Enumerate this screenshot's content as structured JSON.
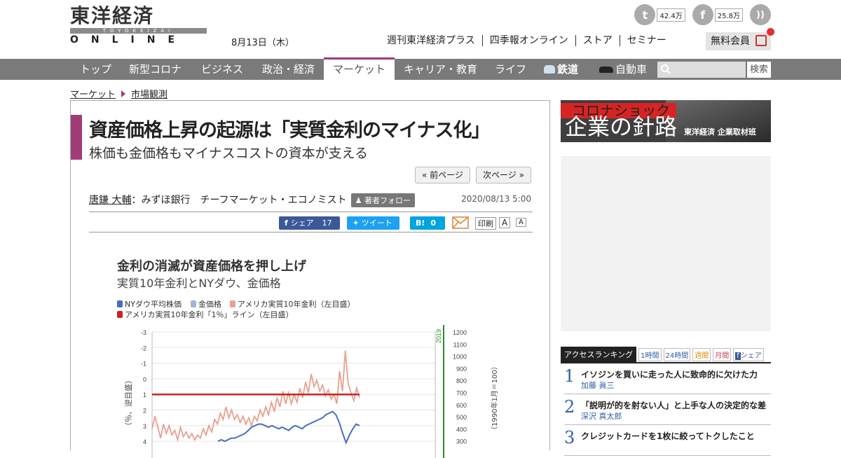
{
  "header": {
    "logo_kanji": "東洋経済",
    "logo_roman": "TOYOKEIZAI",
    "logo_online": "ONLINE",
    "date": "8月13日（木）",
    "social": [
      {
        "name": "twitter",
        "icon": "twitter-icon",
        "count": "42.4万"
      },
      {
        "name": "facebook",
        "icon": "facebook-icon",
        "count": "25.8万"
      },
      {
        "name": "rss",
        "icon": "rss-icon",
        "count": ""
      }
    ],
    "links": [
      "週刊東洋経済プラス",
      "四季報オンライン",
      "ストア",
      "セミナー"
    ],
    "member": "無料会員"
  },
  "nav": {
    "items": [
      "トップ",
      "新型コロナ",
      "ビジネス",
      "政治・経済",
      "マーケット",
      "キャリア・教育",
      "ライフ",
      "鉄道",
      "自動車"
    ],
    "active": "マーケット",
    "search_button": "検索"
  },
  "breadcrumb": [
    "マーケット",
    "市場観測"
  ],
  "article": {
    "title": "資産価格上昇の起源は「実質金利のマイナス化」",
    "subtitle": "株価も金価格もマイナスコストの資本が支える",
    "prev": "« 前ページ",
    "next": "次ページ »",
    "author_name": "唐鎌 大輔",
    "author_affiliation": "：みずほ銀行　チーフマーケット・エコノミスト",
    "follow": "著者フォロー",
    "pubdate": "2020/08/13 5:00",
    "share": {
      "facebook": "シェア",
      "facebook_count": "17",
      "tweet": "ツイート",
      "hatena": "B!",
      "hatena_count": "0",
      "print": "印刷",
      "font_a1": "A",
      "font_a2": "A"
    }
  },
  "chart_data": {
    "type": "line",
    "title": "金利の消滅が資産価格を押し上げ",
    "subtitle": "実質10年金利とNYダウ、金価格",
    "legend": [
      {
        "name": "NYダウ平均株価",
        "color": "#4a6cc0"
      },
      {
        "name": "金価格",
        "color": "#9fb4e0"
      },
      {
        "name": "アメリカ実質10年金利（左目盛）",
        "color": "#e8a090"
      },
      {
        "name": "アメリカ実質10年金利「1％」ライン（左目盛）",
        "color": "#cc2222"
      }
    ],
    "y_left_ticks": [
      "-3",
      "-2",
      "-1",
      "0",
      "1",
      "2",
      "3",
      "4"
    ],
    "y_left_label": "（％、逆目盛）",
    "y_right_ticks": [
      "1200",
      "1100",
      "1000",
      "900",
      "800",
      "700",
      "600",
      "500",
      "400",
      "300"
    ],
    "y_right_label": "（1990年1月＝100）",
    "marker_label": "2019",
    "rate_series": [
      3.2,
      2.4,
      3.1,
      3.8,
      2.9,
      3.5,
      3.0,
      3.6,
      3.3,
      3.9,
      3.1,
      3.7,
      3.4,
      3.8,
      3.5,
      3.9,
      3.6,
      3.8,
      3.2,
      3.6,
      3.0,
      3.4,
      2.6,
      2.9,
      2.2,
      2.6,
      1.8,
      2.5,
      2.0,
      2.6,
      2.3,
      2.8,
      2.4,
      2.9,
      2.5,
      3.0,
      2.4,
      2.7,
      2.0,
      2.4,
      1.8,
      2.3,
      1.5,
      2.1,
      1.2,
      1.8,
      0.8,
      1.6,
      0.9,
      1.6,
      1.0,
      1.5,
      0.6,
      1.2,
      0.2,
      0.9,
      -0.3,
      0.5,
      0.1,
      0.8,
      0.4,
      1.1,
      0.7,
      1.3,
      1.0,
      1.6,
      -0.5,
      0.8,
      -1.8,
      0.3,
      0.9,
      1.4,
      0.6,
      1.2
    ],
    "dow_series": [
      4.0,
      3.9,
      4.0,
      3.9,
      3.8,
      3.8,
      3.7,
      3.6,
      3.5,
      3.3,
      3.1,
      3.0,
      2.9,
      2.9,
      3.0,
      3.1,
      3.0,
      3.1,
      3.2,
      3.1,
      3.2,
      3.3,
      3.1,
      3.0,
      3.1,
      3.2,
      3.0,
      2.9,
      2.8,
      2.7,
      2.6,
      2.5,
      2.3,
      2.2,
      2.1,
      2.3,
      2.8,
      3.5,
      4.1,
      3.6,
      3.2,
      2.9,
      3.0
    ],
    "red_line_value": 1
  },
  "sidebar": {
    "banner_red": "コロナショック",
    "banner_main": "企業の針路",
    "banner_sub": "東洋経済 企業取材班",
    "ranking_label": "アクセスランキング",
    "ranking_tabs": [
      "1時間",
      "24時間",
      "週間",
      "月間",
      "シェア"
    ],
    "ranking": [
      {
        "rank": "1",
        "title": "イソジンを買いに走った人に致命的に欠けた力",
        "author": "加藤 眞三"
      },
      {
        "rank": "2",
        "title": "「説明が的を射ない人」と上手な人の決定的な差",
        "author": "深沢 真太郎"
      },
      {
        "rank": "3",
        "title": "クレジットカードを1枚に絞ってトクしたこと",
        "author": ""
      }
    ]
  }
}
